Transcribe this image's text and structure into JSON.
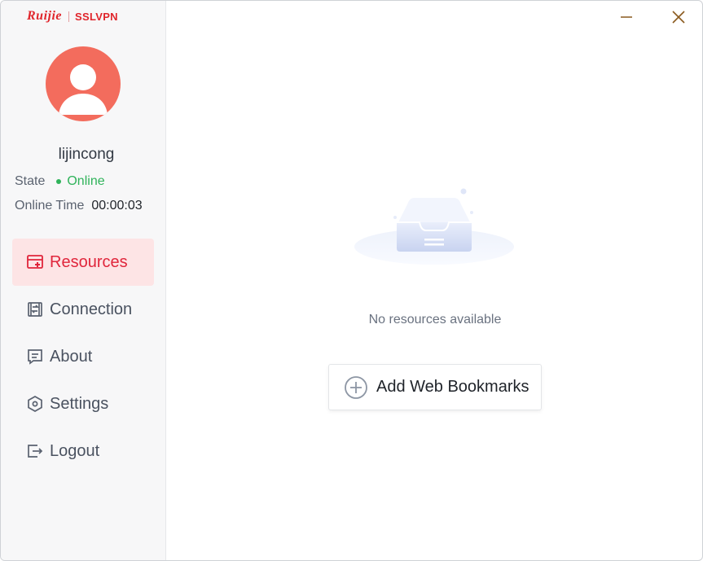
{
  "brand": {
    "logo": "Ruijie",
    "product": "SSLVPN",
    "color": "#e0252b"
  },
  "window_controls": {
    "minimize_icon": "minimize-icon",
    "close_icon": "close-icon",
    "color": "#8a5a1e"
  },
  "user": {
    "avatar_icon": "user-avatar-icon",
    "avatar_color": "#f36c5d",
    "name": "lijincong",
    "state_label": "State",
    "state_value": "Online",
    "state_color": "#2fb35a",
    "online_time_label": "Online Time",
    "online_time_value": "00:00:03"
  },
  "nav": {
    "items": [
      {
        "label": "Resources",
        "icon": "resources-icon",
        "active": true
      },
      {
        "label": "Connection",
        "icon": "connection-icon",
        "active": false
      },
      {
        "label": "About",
        "icon": "about-icon",
        "active": false
      },
      {
        "label": "Settings",
        "icon": "settings-icon",
        "active": false
      },
      {
        "label": "Logout",
        "icon": "logout-icon",
        "active": false
      }
    ],
    "active_color": "#e0253b",
    "active_bg": "#fde4e5"
  },
  "main": {
    "empty_icon": "empty-inbox-icon",
    "empty_text": "No resources available",
    "add_button_label": "Add Web Bookmarks",
    "add_button_icon": "plus-circle-icon"
  }
}
